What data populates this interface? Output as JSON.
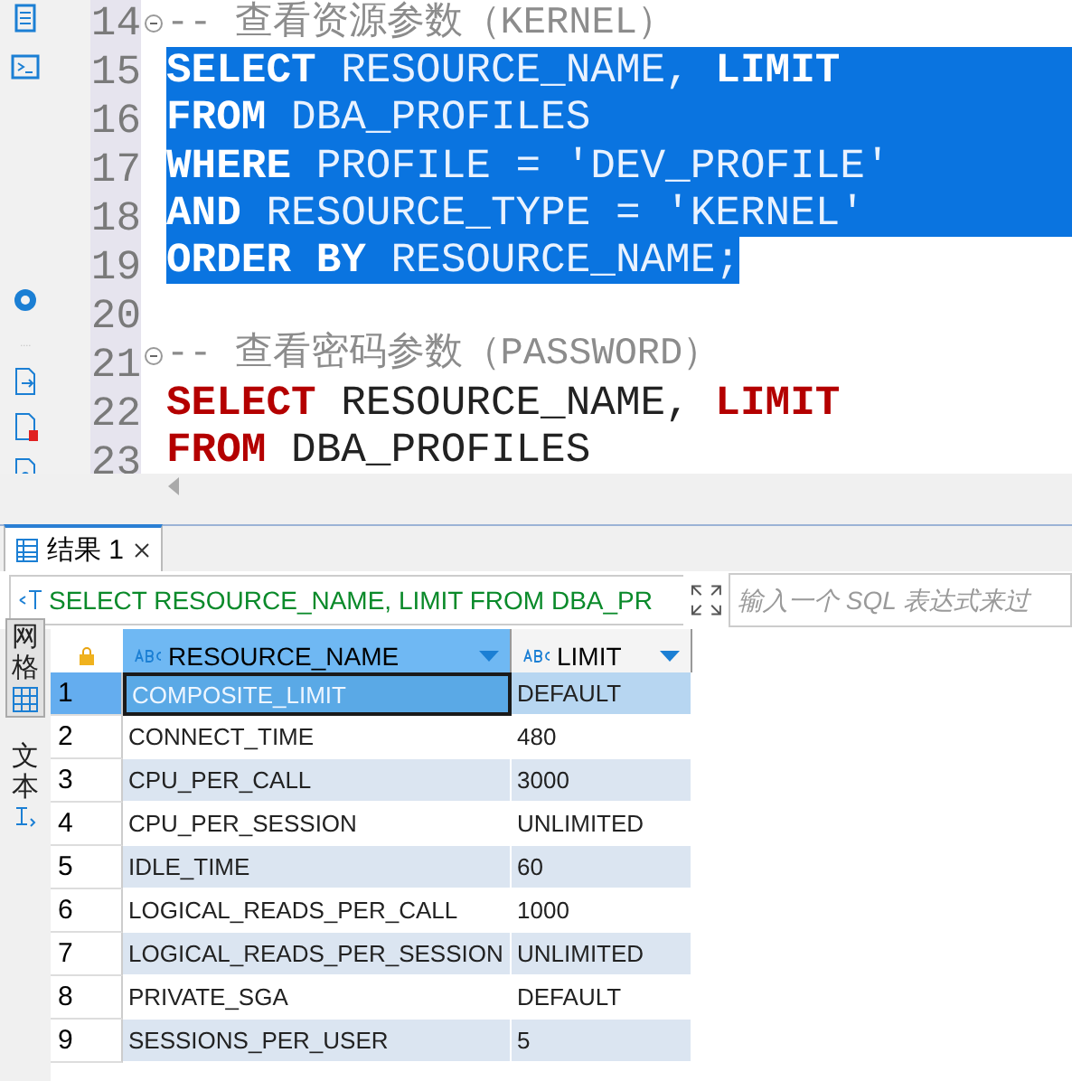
{
  "editor": {
    "lines": [
      {
        "number": "14",
        "fold": true,
        "selected": false,
        "tokens": [
          {
            "kind": "comment",
            "text": "-- 查看资源参数（KERNEL）"
          }
        ]
      },
      {
        "number": "15",
        "fold": false,
        "selected": true,
        "tokens": [
          {
            "kind": "keyword",
            "text": "SELECT"
          },
          {
            "kind": "plain",
            "text": " RESOURCE_NAME, "
          },
          {
            "kind": "keyword",
            "text": "LIMIT"
          }
        ]
      },
      {
        "number": "16",
        "fold": false,
        "selected": true,
        "tokens": [
          {
            "kind": "keyword",
            "text": "FROM"
          },
          {
            "kind": "plain",
            "text": " DBA_PROFILES"
          }
        ]
      },
      {
        "number": "17",
        "fold": false,
        "selected": true,
        "tokens": [
          {
            "kind": "keyword",
            "text": "WHERE"
          },
          {
            "kind": "plain",
            "text": " PROFILE = 'DEV_PROFILE'"
          }
        ]
      },
      {
        "number": "18",
        "fold": false,
        "selected": true,
        "tokens": [
          {
            "kind": "keyword",
            "text": "AND"
          },
          {
            "kind": "plain",
            "text": " RESOURCE_TYPE = 'KERNEL'"
          }
        ]
      },
      {
        "number": "19",
        "fold": false,
        "selected": true,
        "tokens": [
          {
            "kind": "keyword",
            "text": "ORDER BY"
          },
          {
            "kind": "plain",
            "text": " RESOURCE_NAME;"
          }
        ]
      },
      {
        "number": "20",
        "fold": false,
        "selected": false
      },
      {
        "number": "21",
        "fold": true,
        "selected": false,
        "tokens": [
          {
            "kind": "comment",
            "text": "-- 查看密码参数（PASSWORD）"
          }
        ]
      },
      {
        "number": "22",
        "fold": false,
        "selected": false,
        "tokens": [
          {
            "kind": "keyword",
            "text": "SELECT"
          },
          {
            "kind": "plain",
            "text": " RESOURCE_NAME, "
          },
          {
            "kind": "keyword",
            "text": "LIMIT"
          }
        ]
      },
      {
        "number": "23",
        "fold": false,
        "selected": false,
        "tokens": [
          {
            "kind": "keyword",
            "text": "FROM"
          },
          {
            "kind": "plain",
            "text": " DBA_PROFILES"
          }
        ]
      }
    ]
  },
  "results": {
    "tab": {
      "label": "结果 1",
      "selected": true
    },
    "query": "SELECT RESOURCE_NAME, LIMIT FROM DBA_PR",
    "filter": {
      "placeholder": "输入一个 SQL 表达式来过"
    },
    "side_tabs": [
      {
        "label": "网格",
        "selected": true
      },
      {
        "label": "文本",
        "selected": false
      }
    ],
    "columns": [
      {
        "label": "RESOURCE_NAME",
        "selected": true
      },
      {
        "label": "LIMIT",
        "selected": false
      }
    ],
    "rows": [
      {
        "number": "1",
        "selected": true,
        "cells": [
          "COMPOSITE_LIMIT",
          "DEFAULT"
        ]
      },
      {
        "number": "2",
        "selected": false,
        "cells": [
          "CONNECT_TIME",
          "480"
        ]
      },
      {
        "number": "3",
        "selected": false,
        "cells": [
          "CPU_PER_CALL",
          "3000"
        ]
      },
      {
        "number": "4",
        "selected": false,
        "cells": [
          "CPU_PER_SESSION",
          "UNLIMITED"
        ]
      },
      {
        "number": "5",
        "selected": false,
        "cells": [
          "IDLE_TIME",
          "60"
        ]
      },
      {
        "number": "6",
        "selected": false,
        "cells": [
          "LOGICAL_READS_PER_CALL",
          "1000"
        ]
      },
      {
        "number": "7",
        "selected": false,
        "cells": [
          "LOGICAL_READS_PER_SESSION",
          "UNLIMITED"
        ]
      },
      {
        "number": "8",
        "selected": false,
        "cells": [
          "PRIVATE_SGA",
          "DEFAULT"
        ]
      },
      {
        "number": "9",
        "selected": false,
        "cells": [
          "SESSIONS_PER_USER",
          "5"
        ]
      }
    ]
  }
}
